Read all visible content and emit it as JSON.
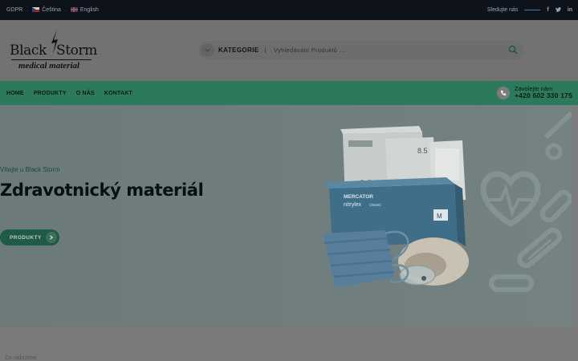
{
  "topbar": {
    "gdpr": "GDPR",
    "separator": ".",
    "lang_cz": "Čeština",
    "lang_en": "English",
    "follow_label": "Sledujte nás",
    "social": {
      "facebook": "f",
      "twitter": "t",
      "linkedin": "in"
    }
  },
  "header": {
    "logo": {
      "brand_left": "Black",
      "brand_right": "Storm",
      "tagline": "medical material"
    },
    "search": {
      "category_label": "KATEGORIE",
      "placeholder": "Vyhledávání Produktů ..."
    }
  },
  "nav": {
    "items": [
      "HOME",
      "PRODUKTY",
      "O NÁS",
      "KONTAKT"
    ],
    "phone_label": "Zavolejte nám",
    "phone_number": "+420 602 330 175"
  },
  "hero": {
    "welcome": "Vítejte u Black Storm",
    "title": "Zdravotnický materiál",
    "cta_label": "PRODUKTY",
    "box_size_1": "8.5",
    "box_size_2": "8.5",
    "box_brand": "MERCATOR",
    "box_product": "nitrylex",
    "box_variant": "classic",
    "box_size_3": "M"
  },
  "below": {
    "teaser": "Co nabízíme"
  },
  "colors": {
    "topbar_bg": "#0e131b",
    "header_bg": "#727272",
    "nav_bg": "#2a7a5b",
    "hero_bg": "#6f7d7d",
    "accent_green": "#1f5a44"
  }
}
